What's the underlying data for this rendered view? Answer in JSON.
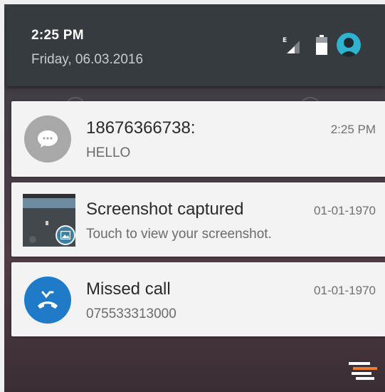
{
  "status": {
    "time": "2:25 PM",
    "date": "Friday, 06.03.2016",
    "network_type": "E"
  },
  "notifications": [
    {
      "title": "18676366738:",
      "text": "HELLO",
      "time": "2:25 PM",
      "icon": "message-icon",
      "icon_color": "#a8a8a8"
    },
    {
      "title": "Screenshot captured",
      "text": "Touch to view your screenshot.",
      "time": "01-01-1970",
      "icon": "screenshot-thumbnail",
      "icon_color": "#3c7fa0"
    },
    {
      "title": "Missed call",
      "text": "075533313000",
      "time": "01-01-1970",
      "icon": "missed-call-icon",
      "icon_color": "#1f7bc8"
    }
  ],
  "colors": {
    "header_bg": "#353b3f",
    "card_bg": "#f3f3f3",
    "avatar": "#2fb3d1",
    "dismiss_accent": "#f07c2a"
  }
}
